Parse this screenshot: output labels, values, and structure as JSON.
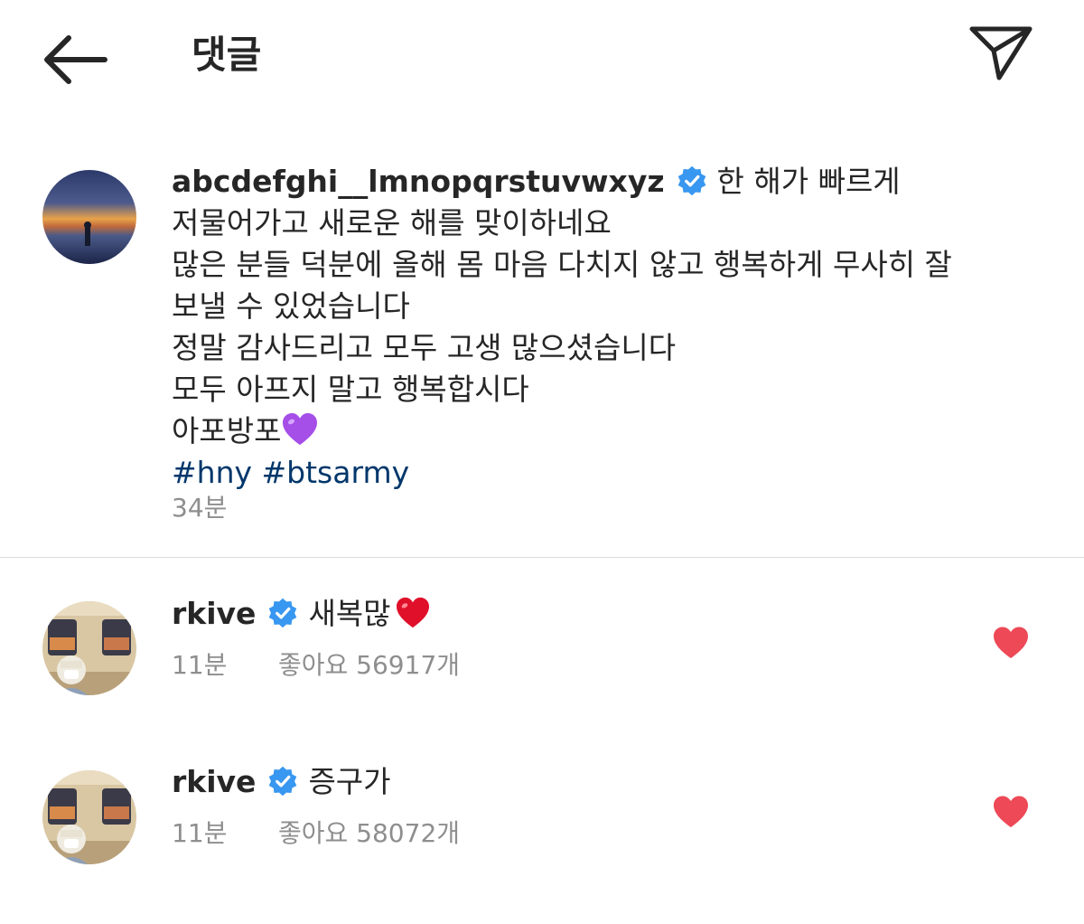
{
  "header": {
    "title": "댓글",
    "back_icon": "back-arrow-icon",
    "share_icon": "paper-plane-icon"
  },
  "caption": {
    "username": "abcdefghi__lmnopqrstuvwxyz",
    "first_line_text": "한 해가 빠르게",
    "lines": [
      "저물어가고 새로운 해를 맞이하네요",
      "많은 분들 덕분에 올해 몸 마음 다치지 않고 행복하게 무사히 잘",
      "보낼 수 있었습니다",
      "정말 감사드리고 모두 고생 많으셨습니다",
      "모두 아프지 말고 행복합시다",
      "아포방포"
    ],
    "hashtags": [
      "#hny",
      "#btsarmy"
    ],
    "time": "34분"
  },
  "comments": [
    {
      "username": "rkive",
      "text": "새복많",
      "time": "11분",
      "likes": "좋아요 56917개"
    },
    {
      "username": "rkive",
      "text": "증구가",
      "time": "11분",
      "likes": "좋아요 58072개"
    }
  ],
  "colors": {
    "verified": "#3897f0",
    "like": "#ed4956",
    "hashtag": "#00376b",
    "muted": "#8e8e8e",
    "purple_heart": "#a64ee8"
  }
}
